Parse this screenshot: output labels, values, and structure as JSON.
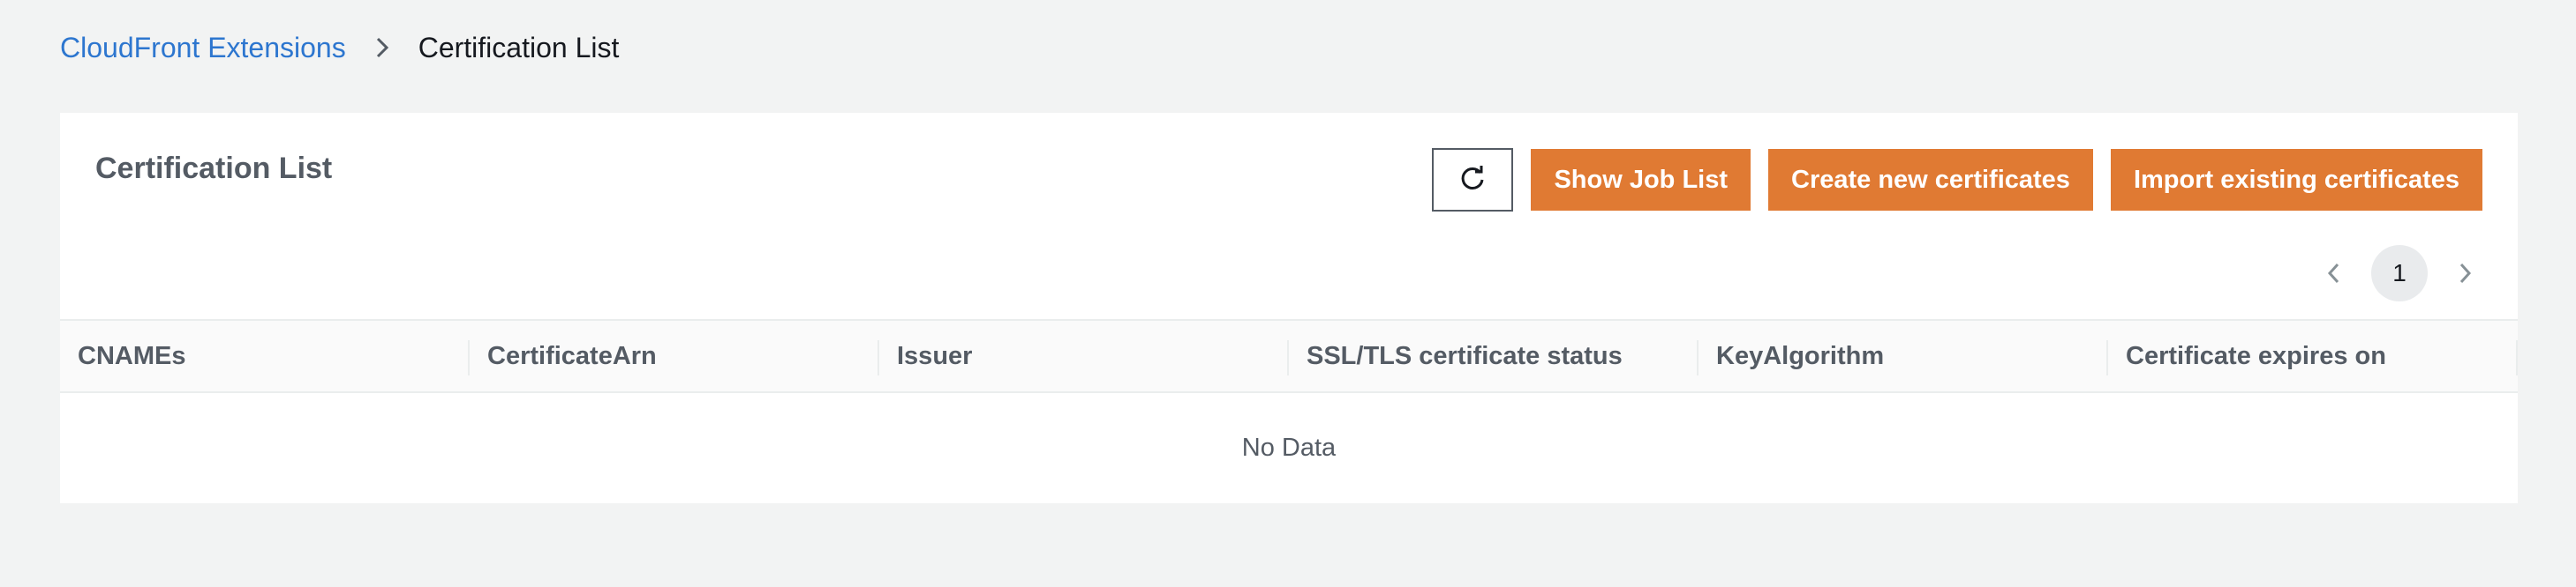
{
  "breadcrumb": {
    "parent": "CloudFront Extensions",
    "current": "Certification List"
  },
  "panel": {
    "title": "Certification List",
    "buttons": {
      "refresh_icon": "refresh-icon",
      "show_job_list": "Show Job List",
      "create_new": "Create new certificates",
      "import_existing": "Import existing certificates"
    }
  },
  "pagination": {
    "current_page": "1"
  },
  "table": {
    "columns": [
      "CNAMEs",
      "CertificateArn",
      "Issuer",
      "SSL/TLS certificate status",
      "KeyAlgorithm",
      "Certificate expires on"
    ],
    "empty_text": "No Data"
  },
  "colors": {
    "accent": "#e07a33",
    "link": "#2d76cf",
    "background": "#f2f3f3"
  }
}
